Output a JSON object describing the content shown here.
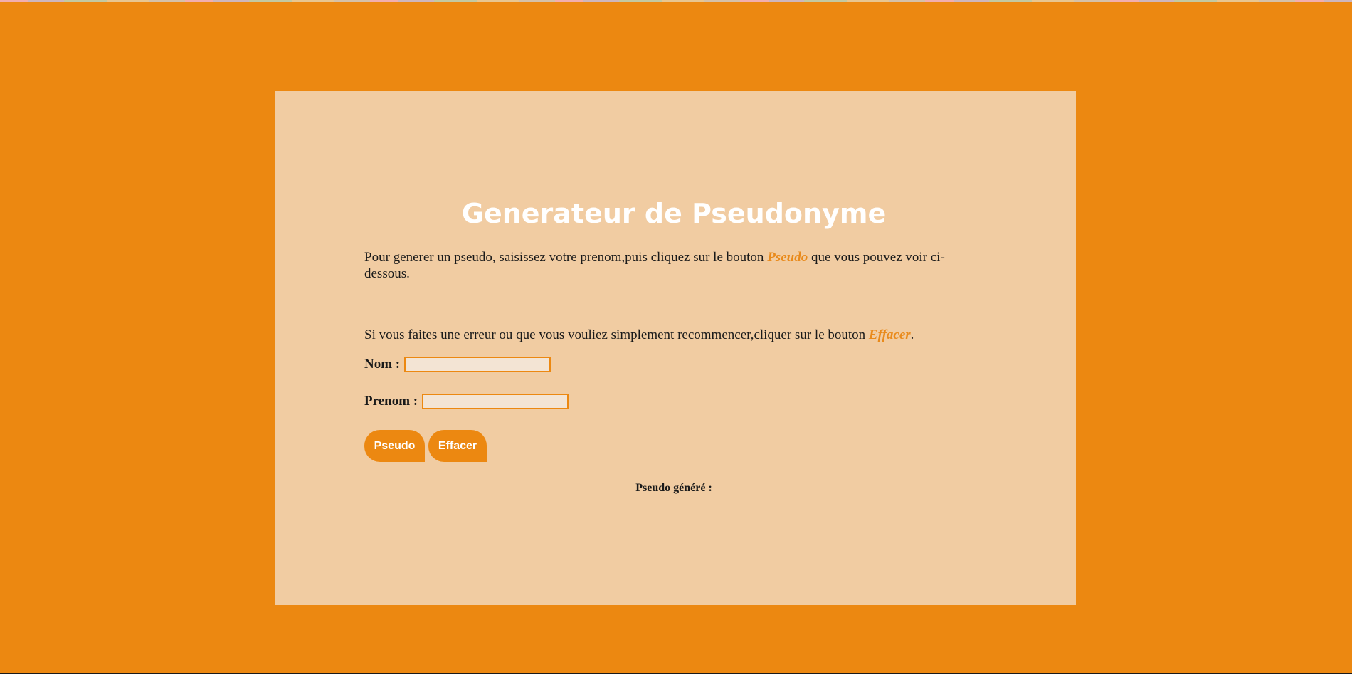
{
  "page": {
    "title": "Generateur de Pseudonyme",
    "intro_before": "Pour generer un pseudo, saisissez votre prenom,puis cliquez sur le bouton ",
    "intro_highlight": "Pseudo",
    "intro_after": " que vous pouvez voir ci-dessous.",
    "reset_before": "Si vous faites une erreur ou que vous vouliez simplement recommencer,cliquer sur le bouton ",
    "reset_highlight": "Effacer",
    "reset_after": "."
  },
  "form": {
    "nom_label": "Nom :",
    "nom_value": "",
    "prenom_label": "Prenom :",
    "prenom_value": ""
  },
  "buttons": {
    "pseudo_label": "Pseudo",
    "effacer_label": "Effacer"
  },
  "result": {
    "label": "Pseudo généré :"
  },
  "colors": {
    "background": "#ec8811",
    "panel": "#f1cca2",
    "accent": "#e98a1b",
    "title": "#ffffff"
  }
}
